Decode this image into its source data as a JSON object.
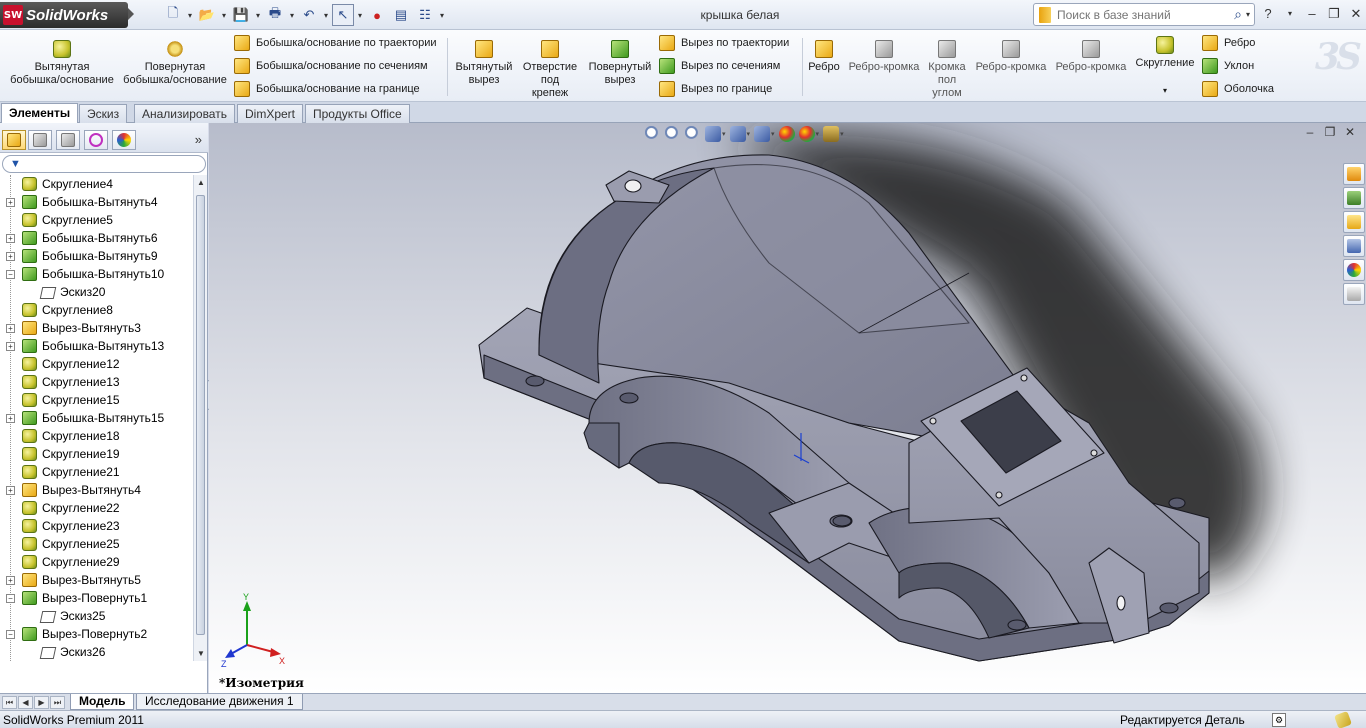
{
  "app": {
    "logo_text": "SolidWorks",
    "logo_mark": "SW",
    "document_title": "крышка белая",
    "search_placeholder": "Поиск в базе знаний",
    "help_label": "?"
  },
  "quick_access": [
    {
      "icon": "new-document-icon",
      "glyph": "🗋"
    },
    {
      "icon": "open-folder-icon",
      "glyph": "📂"
    },
    {
      "icon": "save-icon",
      "glyph": "💾"
    },
    {
      "icon": "print-icon",
      "glyph": "🖶"
    },
    {
      "icon": "undo-icon",
      "glyph": "↶"
    },
    {
      "icon": "select-pointer-icon",
      "glyph": "↖"
    },
    {
      "icon": "rebuild-traffic-light-icon",
      "glyph": "🚦"
    },
    {
      "icon": "file-properties-icon",
      "glyph": "▤"
    },
    {
      "icon": "options-icon",
      "glyph": "☷"
    }
  ],
  "ribbon": {
    "extruded_boss": "Вытянутая\nбобышка/основание",
    "revolved_boss": "Повернутая\nбобышка/основание",
    "swept_boss": "Бобышка/основание по траектории",
    "lofted_boss": "Бобышка/основание по сечениям",
    "boundary_boss": "Бобышка/основание на границе",
    "extruded_cut": "Вытянутый\nвырез",
    "hole_wizard": "Отверстие\nпод\nкрепеж",
    "revolved_cut": "Повернутый\nвырез",
    "swept_cut": "Вырез по траектории",
    "lofted_cut": "Вырез по сечениям",
    "boundary_cut": "Вырез по границе",
    "rib": "Ребро",
    "rib_edge_1": "Ребро-кромка",
    "edge_flange": "Кромка\nпол\nуглом",
    "rib_edge_2": "Ребро-кромка",
    "rib_edge_3": "Ребро-кромка",
    "fillet": "Скругление",
    "rib_small": "Ребро",
    "draft": "Уклон",
    "shell": "Оболочка"
  },
  "tabs": [
    "Элементы",
    "Эскиз",
    "Анализировать",
    "DimXpert",
    "Продукты Office"
  ],
  "feature_tree": [
    {
      "label": "Скругление4",
      "type": "fillet",
      "expand": false
    },
    {
      "label": "Бобышка-Вытянуть4",
      "type": "boss",
      "expand": true
    },
    {
      "label": "Скругление5",
      "type": "fillet",
      "expand": false
    },
    {
      "label": "Бобышка-Вытянуть6",
      "type": "boss",
      "expand": true
    },
    {
      "label": "Бобышка-Вытянуть9",
      "type": "boss",
      "expand": true
    },
    {
      "label": "Бобышка-Вытянуть10",
      "type": "boss",
      "expand": true,
      "open": true
    },
    {
      "label": "Эскиз20",
      "type": "sketch",
      "child": true
    },
    {
      "label": "Скругление8",
      "type": "fillet",
      "expand": false
    },
    {
      "label": "Вырез-Вытянуть3",
      "type": "cut",
      "expand": true
    },
    {
      "label": "Бобышка-Вытянуть13",
      "type": "boss",
      "expand": true
    },
    {
      "label": "Скругление12",
      "type": "fillet",
      "expand": false
    },
    {
      "label": "Скругление13",
      "type": "fillet",
      "expand": false
    },
    {
      "label": "Скругление15",
      "type": "fillet",
      "expand": false
    },
    {
      "label": "Бобышка-Вытянуть15",
      "type": "boss",
      "expand": true
    },
    {
      "label": "Скругление18",
      "type": "fillet",
      "expand": false
    },
    {
      "label": "Скругление19",
      "type": "fillet",
      "expand": false
    },
    {
      "label": "Скругление21",
      "type": "fillet",
      "expand": false
    },
    {
      "label": "Вырез-Вытянуть4",
      "type": "cut",
      "expand": true
    },
    {
      "label": "Скругление22",
      "type": "fillet",
      "expand": false
    },
    {
      "label": "Скругление23",
      "type": "fillet",
      "expand": false
    },
    {
      "label": "Скругление25",
      "type": "fillet",
      "expand": false
    },
    {
      "label": "Скругление29",
      "type": "fillet",
      "expand": false
    },
    {
      "label": "Вырез-Вытянуть5",
      "type": "cut",
      "expand": true
    },
    {
      "label": "Вырез-Повернуть1",
      "type": "rcut",
      "expand": true,
      "open": true
    },
    {
      "label": "Эскиз25",
      "type": "sketch",
      "child": true
    },
    {
      "label": "Вырез-Повернуть2",
      "type": "rcut",
      "expand": true,
      "open": true
    },
    {
      "label": "Эскиз26",
      "type": "sketch",
      "child": true
    }
  ],
  "viewport": {
    "view_label": "*Изометрия",
    "triad": {
      "x": "X",
      "y": "Y",
      "z": "Z"
    }
  },
  "bottom_tabs": [
    "Модель",
    "Исследование движения 1"
  ],
  "status": {
    "product": "SolidWorks Premium 2011",
    "mode": "Редактируется Деталь"
  },
  "colors": {
    "model_face": "#8e90a2",
    "model_edge": "#1a1a22",
    "tree_selected": "#ffffff"
  }
}
